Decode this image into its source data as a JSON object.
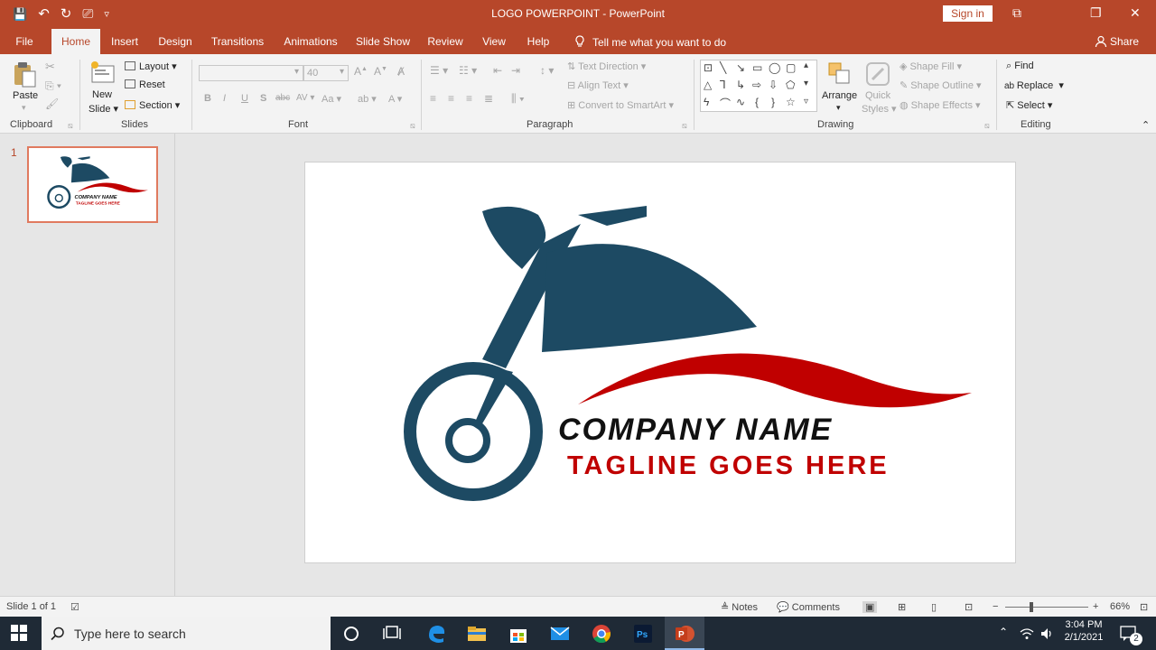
{
  "window": {
    "title": "LOGO POWERPOINT  -  PowerPoint",
    "signin": "Sign in",
    "controls": {
      "restore_ribbon": "⧉",
      "maximize": "❐",
      "close": "✕"
    }
  },
  "qat": {
    "save": "💾",
    "undo": "↶",
    "redo": "↻",
    "present": "⎚",
    "customize": "▿"
  },
  "tabs": [
    {
      "label": "File"
    },
    {
      "label": "Home"
    },
    {
      "label": "Insert"
    },
    {
      "label": "Design"
    },
    {
      "label": "Transitions"
    },
    {
      "label": "Animations"
    },
    {
      "label": "Slide Show"
    },
    {
      "label": "Review"
    },
    {
      "label": "View"
    },
    {
      "label": "Help"
    }
  ],
  "tellme": "Tell me what you want to do",
  "share": "Share",
  "ribbon": {
    "clipboard": {
      "paste": "Paste",
      "label": "Clipboard"
    },
    "slides": {
      "new_slide_line1": "New",
      "new_slide_line2": "Slide",
      "layout": "Layout",
      "reset": "Reset",
      "section": "Section",
      "label": "Slides"
    },
    "font": {
      "size": "40",
      "bold": "B",
      "italic": "I",
      "underline": "U",
      "shadow": "S",
      "strike": "abc",
      "spacing": "AV",
      "case": "Aa",
      "label": "Font"
    },
    "paragraph": {
      "text_direction": "Text Direction",
      "align_text": "Align Text",
      "smartart": "Convert to SmartArt",
      "label": "Paragraph"
    },
    "drawing": {
      "arrange": "Arrange",
      "quick_line1": "Quick",
      "quick_line2": "Styles",
      "shape_fill": "Shape Fill",
      "shape_outline": "Shape Outline",
      "shape_effects": "Shape Effects",
      "label": "Drawing"
    },
    "editing": {
      "find": "Find",
      "replace": "Replace",
      "select": "Select",
      "label": "Editing"
    }
  },
  "slide_panel": {
    "number": "1"
  },
  "slide": {
    "company": "COMPANY NAME",
    "tagline": "TAGLINE GOES HERE",
    "colors": {
      "blue": "#1d4a63",
      "red": "#c00000"
    }
  },
  "status": {
    "slide_of": "Slide 1 of 1",
    "notes": "Notes",
    "comments": "Comments",
    "zoom": "66%"
  },
  "taskbar": {
    "search_placeholder": "Type here to search",
    "time": "3:04 PM",
    "date": "2/1/2021",
    "notifications": "2"
  }
}
